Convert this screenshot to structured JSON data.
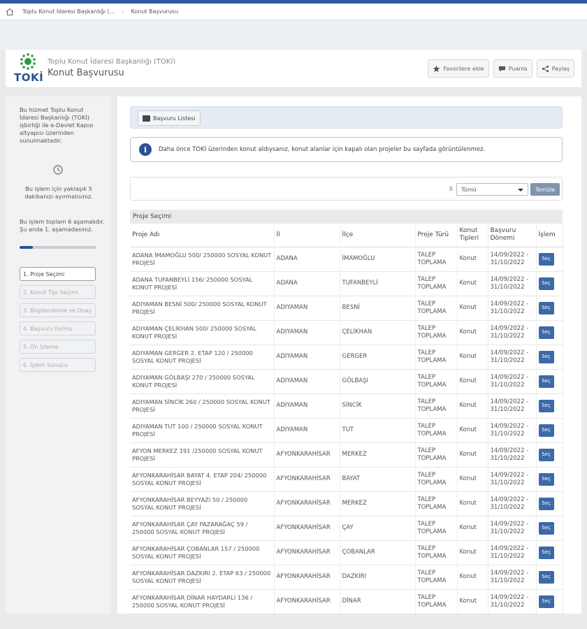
{
  "breadcrumb": {
    "org": "Toplu Konut İdaresi Başkanlığı (...",
    "page": "Konut Başvurusu"
  },
  "header": {
    "logo_text": "TOKİ",
    "org": "Toplu Konut İdaresi Başkanlığı (TOKİ)",
    "title": "Konut Başvurusu",
    "buttons": {
      "favorite": "Favorilere ekle",
      "rate": "Puanla",
      "share": "Paylaş"
    }
  },
  "sidebar": {
    "description": "Bu hizmet Toplu Konut İdaresi Başkanlığı (TOKİ) işbirliği ile e-Devlet Kapısı altyapısı üzerinden sunulmaktadır.",
    "time_note": "Bu işlem için yaklaşık 5 dakikanızı ayırmalısınız.",
    "steps_info": "Bu işlem toplam 6 aşamalıdır. Şu anda 1. aşamadasınız.",
    "progress_fraction": 0.17,
    "steps": [
      "1. Proje Seçimi",
      "2. Konut Tipi Seçimi",
      "3. Bilgilendirme ve Onay",
      "4. Başvuru Formu",
      "5. Ön İzleme",
      "6. İşlem Sonucu"
    ]
  },
  "main": {
    "tab_label": "Başvuru Listesi",
    "info_text": "Daha önce TOKİ üzerinden konut aldıysanız, konut alanlar için kapalı olan projeler bu sayfada görüntülenmez.",
    "filter": {
      "label": "İl",
      "selected": "Tümü",
      "clear_label": "Temizle"
    },
    "section_title": "Proje Seçimi",
    "columns": [
      "Proje Adı",
      "İl",
      "İlçe",
      "Proje Türü",
      "Konut Tipleri",
      "Başvuru Dönemi",
      "İşlem"
    ],
    "action_label": "Seç",
    "rows": [
      [
        "ADANA İMAMOĞLU 500/ 250000 SOSYAL KONUT PROJESİ",
        "ADANA",
        "İMAMOĞLU",
        "TALEP TOPLAMA",
        "Konut",
        "14/09/2022 - 31/10/2022"
      ],
      [
        "ADANA TUFANBEYLİ 156/ 250000 SOSYAL KONUT PROJESİ",
        "ADANA",
        "TUFANBEYLİ",
        "TALEP TOPLAMA",
        "Konut",
        "14/09/2022 - 31/10/2022"
      ],
      [
        "ADIYAMAN BESNİ 500/ 250000 SOSYAL KONUT PROJESİ",
        "ADIYAMAN",
        "BESNİ",
        "TALEP TOPLAMA",
        "Konut",
        "14/09/2022 - 31/10/2022"
      ],
      [
        "ADIYAMAN ÇELİKHAN 500/ 250000 SOSYAL KONUT PROJESİ",
        "ADIYAMAN",
        "ÇELİKHAN",
        "TALEP TOPLAMA",
        "Konut",
        "14/09/2022 - 31/10/2022"
      ],
      [
        "ADIYAMAN GERGER 2. ETAP 120 / 250000 SOSYAL KONUT PROJESİ",
        "ADIYAMAN",
        "GERGER",
        "TALEP TOPLAMA",
        "Konut",
        "14/09/2022 - 31/10/2022"
      ],
      [
        "ADIYAMAN GÖLBAŞI 270 / 250000 SOSYAL KONUT PROJESİ",
        "ADIYAMAN",
        "GÖLBAŞI",
        "TALEP TOPLAMA",
        "Konut",
        "14/09/2022 - 31/10/2022"
      ],
      [
        "ADIYAMAN SİNCİK 260 / 250000 SOSYAL KONUT PROJESİ",
        "ADIYAMAN",
        "SİNCİK",
        "TALEP TOPLAMA",
        "Konut",
        "14/09/2022 - 31/10/2022"
      ],
      [
        "ADIYAMAN TUT 100 / 250000 SOSYAL KONUT PROJESİ",
        "ADIYAMAN",
        "TUT",
        "TALEP TOPLAMA",
        "Konut",
        "14/09/2022 - 31/10/2022"
      ],
      [
        "AFYON MERKEZ 191 /250000 SOSYAL KONUT PROJESİ",
        "AFYONKARAHİSAR",
        "MERKEZ",
        "TALEP TOPLAMA",
        "Konut",
        "14/09/2022 - 31/10/2022"
      ],
      [
        "AFYONKARAHİSAR BAYAT 4. ETAP 204/ 250000 SOSYAL KONUT PROJESİ",
        "AFYONKARAHİSAR",
        "BAYAT",
        "TALEP TOPLAMA",
        "Konut",
        "14/09/2022 - 31/10/2022"
      ],
      [
        "AFYONKARAHİSAR BEYYAZI 50 / 250000 SOSYAL KONUT PROJESİ",
        "AFYONKARAHİSAR",
        "MERKEZ",
        "TALEP TOPLAMA",
        "Konut",
        "14/09/2022 - 31/10/2022"
      ],
      [
        "AFYONKARAHİSAR ÇAY PAZARAĞAÇ 59 / 250000 SOSYAL KONUT PROJESİ",
        "AFYONKARAHİSAR",
        "ÇAY",
        "TALEP TOPLAMA",
        "Konut",
        "14/09/2022 - 31/10/2022"
      ],
      [
        "AFYONKARAHİSAR ÇOBANLAR 157 / 250000 SOSYAL KONUT PROJESİ",
        "AFYONKARAHİSAR",
        "ÇOBANLAR",
        "TALEP TOPLAMA",
        "Konut",
        "14/09/2022 - 31/10/2022"
      ],
      [
        "AFYONKARAHİSAR DAZKIRI 2. ETAP 63 / 250000 SOSYAL KONUT PROJESİ",
        "AFYONKARAHİSAR",
        "DAZKIRI",
        "TALEP TOPLAMA",
        "Konut",
        "14/09/2022 - 31/10/2022"
      ],
      [
        "AFYONKARAHİSAR DİNAR HAYDARLI 136 / 250000 SOSYAL KONUT PROJESİ",
        "AFYONKARAHİSAR",
        "DİNAR",
        "TALEP TOPLAMA",
        "Konut",
        "14/09/2022 - 31/10/2022"
      ]
    ]
  },
  "colors": {
    "brand_blue": "#2a5097",
    "button_blue": "#3c6aa7",
    "logo_green": "#2e9a3e"
  }
}
